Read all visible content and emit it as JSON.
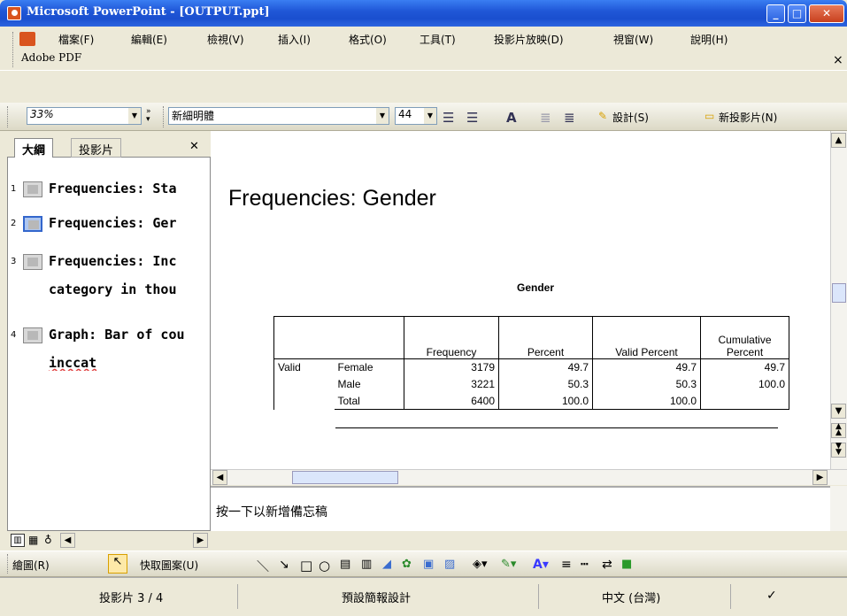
{
  "window": {
    "title": "Microsoft PowerPoint - [OUTPUT.ppt]"
  },
  "menu": {
    "items": [
      "檔案(F)",
      "編輯(E)",
      "檢視(V)",
      "插入(I)",
      "格式(O)",
      "工具(T)",
      "投影片放映(D)",
      "視窗(W)",
      "說明(H)"
    ],
    "adobe": "Adobe PDF"
  },
  "toolbar": {
    "zoom": "33%",
    "font": "新細明體",
    "size": "44",
    "design_label": "設計(S)",
    "new_slide_label": "新投影片(N)"
  },
  "pane": {
    "tabs": [
      "大綱",
      "投影片"
    ],
    "outline": [
      {
        "num": "1",
        "lines": [
          "Frequencies: Sta"
        ]
      },
      {
        "num": "2",
        "lines": [
          "Frequencies: Ger"
        ]
      },
      {
        "num": "3",
        "lines": [
          "Frequencies: Inc",
          "category in thou"
        ]
      },
      {
        "num": "4",
        "lines": [
          "Graph: Bar of cou",
          "inccat"
        ]
      }
    ]
  },
  "slide": {
    "title": "Frequencies: Gender",
    "table_title": "Gender",
    "headers": [
      "Frequency",
      "Percent",
      "Valid Percent",
      "Cumulative",
      "Percent"
    ],
    "group_label": "Valid",
    "rows": [
      {
        "label": "Female",
        "frequency": "3179",
        "percent": "49.7",
        "valid_percent": "49.7",
        "cumulative": "49.7"
      },
      {
        "label": "Male",
        "frequency": "3221",
        "percent": "50.3",
        "valid_percent": "50.3",
        "cumulative": "100.0"
      },
      {
        "label": "Total",
        "frequency": "6400",
        "percent": "100.0",
        "valid_percent": "100.0",
        "cumulative": ""
      }
    ]
  },
  "notes": {
    "placeholder": "按一下以新增備忘稿"
  },
  "draw": {
    "draw_label": "繪圖(R)",
    "autoshape_label": "快取圖案(U)"
  },
  "status": {
    "slide": "投影片 3 / 4",
    "design": "預設簡報設計",
    "language": "中文 (台灣)"
  }
}
